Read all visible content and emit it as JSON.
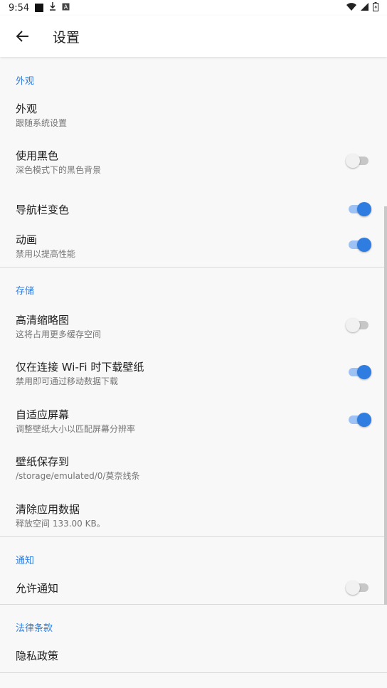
{
  "status_bar": {
    "time": "9:54",
    "icons": [
      "square-notification-icon",
      "download-icon",
      "a-badge-icon",
      "wifi-icon",
      "signal-icon",
      "battery-icon"
    ]
  },
  "app_bar": {
    "back_icon": "arrow-left-icon",
    "title": "设置"
  },
  "colors": {
    "accent": "#2f7de1",
    "switch_on_track": "#9ec2f4",
    "switch_off_thumb": "#f1f1f1"
  },
  "sections": {
    "appearance": {
      "header": "外观",
      "items": [
        {
          "title": "外观",
          "summary": "跟随系统设置"
        },
        {
          "title": "使用黑色",
          "summary": "深色模式下的黑色背景",
          "switch": false
        },
        {
          "title": "导航栏变色",
          "switch": true
        },
        {
          "title": "动画",
          "summary": "禁用以提高性能",
          "switch": true
        }
      ]
    },
    "storage": {
      "header": "存储",
      "items": [
        {
          "title": "高清缩略图",
          "summary": "这将占用更多缓存空间",
          "switch": false
        },
        {
          "title": "仅在连接 Wi-Fi 时下载壁纸",
          "summary": "禁用即可通过移动数据下载",
          "switch": true
        },
        {
          "title": "自适应屏幕",
          "summary": "调整壁纸大小以匹配屏幕分辨率",
          "switch": true
        },
        {
          "title": "壁纸保存到",
          "summary": "/storage/emulated/0/莫奈线条"
        },
        {
          "title": "清除应用数据",
          "summary": "释放空间 133.00 KB。"
        }
      ]
    },
    "notifications": {
      "header": "通知",
      "items": [
        {
          "title": "允许通知",
          "switch": false
        }
      ]
    },
    "legal": {
      "header": "法律条款",
      "items": [
        {
          "title": "隐私政策"
        }
      ]
    }
  }
}
